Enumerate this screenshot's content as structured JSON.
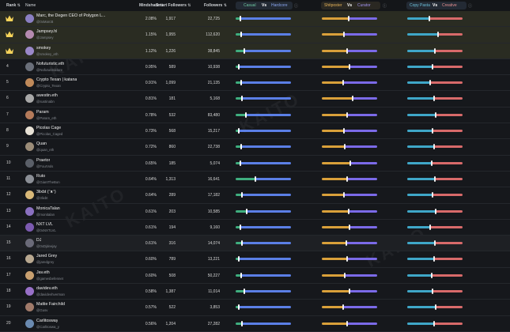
{
  "header": {
    "rank": "Rank",
    "name": "Name",
    "mindshare": "Mindshare",
    "smart_followers": "Smart Followers",
    "followers": "Followers",
    "casual": "Casual",
    "vs1": "Vs",
    "hardcore": "Hardcore",
    "shitposter": "Shitposter",
    "vs2": "Vs",
    "curator": "Curator",
    "copy_pasta": "Copy Pasta",
    "vs3": "Vs",
    "creative": "Creative",
    "watermark": "KAITO"
  },
  "colors": {
    "casual": "#3fae7f",
    "hardcore": "#5b7fe6",
    "shitposter": "#d9a03a",
    "curator": "#7b6ae8",
    "copy_pasta": "#3fa7c8",
    "creative": "#d86a6a",
    "top_row_bg": "#2a2c22",
    "crown": "#f5d35a"
  },
  "rows": [
    {
      "rank": "1",
      "crown": true,
      "name": "Marc, the Degen CEO of Polygon L...",
      "handle": "@0xMarcB",
      "mindshare": "2.08%",
      "smart_followers": "1,917",
      "followers": "22,725",
      "c": 0.08,
      "s": 0.48,
      "p": 0.4,
      "avatar": "#8a7fc2"
    },
    {
      "rank": "2",
      "crown": true,
      "name": "Jampsey.hl",
      "handle": "@Jampsey",
      "mindshare": "1.15%",
      "smart_followers": "1,955",
      "followers": "112,620",
      "c": 0.1,
      "s": 0.4,
      "p": 0.55,
      "avatar": "#b58ab0"
    },
    {
      "rank": "3",
      "crown": true,
      "name": "smokey",
      "handle": "@smokey_eth",
      "mindshare": "1.12%",
      "smart_followers": "1,226",
      "followers": "38,845",
      "c": 0.15,
      "s": 0.45,
      "p": 0.5,
      "avatar": "#9a88c9"
    },
    {
      "rank": "4",
      "crown": false,
      "name": "Nofuturistic.eth",
      "handle": "@Nofuturisticlore",
      "mindshare": "0.95%",
      "smart_followers": "589",
      "followers": "10,938",
      "c": 0.06,
      "s": 0.5,
      "p": 0.45,
      "avatar": "#6a6f7a"
    },
    {
      "rank": "5",
      "crown": false,
      "name": "Crypto Texan | katana",
      "handle": "@Crypto_Texan",
      "mindshare": "0.91%",
      "smart_followers": "1,099",
      "followers": "21,135",
      "c": 0.1,
      "s": 0.38,
      "p": 0.42,
      "avatar": "#c08a5a"
    },
    {
      "rank": "6",
      "crown": false,
      "name": "awestin.eth",
      "handle": "@sustinabn",
      "mindshare": "0.81%",
      "smart_followers": "181",
      "followers": "5,168",
      "c": 0.12,
      "s": 0.55,
      "p": 0.48,
      "avatar": "#a8a8a8"
    },
    {
      "rank": "7",
      "crown": false,
      "name": "Param",
      "handle": "@Param_eth",
      "mindshare": "0.78%",
      "smart_followers": "532",
      "followers": "83,480",
      "c": 0.18,
      "s": 0.45,
      "p": 0.52,
      "avatar": "#b47a5a"
    },
    {
      "rank": "8",
      "crown": false,
      "name": "Picolas Cage",
      "handle": "@Picolas_Caged",
      "mindshare": "0.73%",
      "smart_followers": "568",
      "followers": "15,217",
      "c": 0.06,
      "s": 0.4,
      "p": 0.45,
      "avatar": "#e8e2d6"
    },
    {
      "rank": "9",
      "crown": false,
      "name": "Quan",
      "handle": "@quan_eth",
      "mindshare": "0.72%",
      "smart_followers": "860",
      "followers": "22,738",
      "c": 0.1,
      "s": 0.42,
      "p": 0.48,
      "avatar": "#9b8c78"
    },
    {
      "rank": "10",
      "crown": false,
      "name": "Praetor",
      "handle": "@FourVols",
      "mindshare": "0.65%",
      "smart_followers": "185",
      "followers": "5,074",
      "c": 0.08,
      "s": 0.52,
      "p": 0.44,
      "avatar": "#5a5f68"
    },
    {
      "rank": "11",
      "crown": false,
      "name": "Ruto",
      "handle": "@GiantTheBon",
      "mindshare": "0.64%",
      "smart_followers": "1,313",
      "followers": "16,641",
      "c": 0.35,
      "s": 0.45,
      "p": 0.5,
      "avatar": "#8b8f96"
    },
    {
      "rank": "12",
      "crown": false,
      "name": "3lixbt (ᵔᴥᵔ)",
      "handle": "@3lixbt",
      "mindshare": "0.64%",
      "smart_followers": "289",
      "followers": "17,182",
      "c": 0.12,
      "s": 0.4,
      "p": 0.46,
      "avatar": "#d8b878"
    },
    {
      "rank": "13",
      "crown": false,
      "name": "MonicaTalan",
      "handle": "@monitalan",
      "mindshare": "0.61%",
      "smart_followers": "203",
      "followers": "10,585",
      "c": 0.2,
      "s": 0.48,
      "p": 0.52,
      "avatar": "#8a70c0"
    },
    {
      "rank": "14",
      "crown": false,
      "name": "NXT LVL",
      "handle": "@0xNXTLVL",
      "mindshare": "0.61%",
      "smart_followers": "194",
      "followers": "9,160",
      "c": 0.08,
      "s": 0.5,
      "p": 0.42,
      "avatar": "#7c5ab0"
    },
    {
      "rank": "15",
      "crown": false,
      "name": "DJ",
      "handle": "@0xDjdeejay",
      "mindshare": "0.61%",
      "smart_followers": "316",
      "followers": "14,074",
      "c": 0.12,
      "s": 0.44,
      "p": 0.5,
      "avatar": "#6a6a78"
    },
    {
      "rank": "16",
      "crown": false,
      "name": "Jared Grey",
      "handle": "@jaredgrey",
      "mindshare": "0.60%",
      "smart_followers": "789",
      "followers": "13,221",
      "c": 0.06,
      "s": 0.46,
      "p": 0.48,
      "avatar": "#b8a890"
    },
    {
      "rank": "17",
      "crown": false,
      "name": "Jav.eth",
      "handle": "@gamesbefennet",
      "mindshare": "0.60%",
      "smart_followers": "508",
      "followers": "50,227",
      "c": 0.1,
      "s": 0.42,
      "p": 0.44,
      "avatar": "#c8a070"
    },
    {
      "rank": "18",
      "crown": false,
      "name": "davidev.eth",
      "handle": "@davidevhverman",
      "mindshare": "0.58%",
      "smart_followers": "1,387",
      "followers": "11,014",
      "c": 0.15,
      "s": 0.5,
      "p": 0.46,
      "avatar": "#9870c8"
    },
    {
      "rank": "19",
      "crown": false,
      "name": "Mattie Fairchild",
      "handle": "@Gusv",
      "mindshare": "0.57%",
      "smart_followers": "522",
      "followers": "3,853",
      "c": 0.05,
      "s": 0.38,
      "p": 0.52,
      "avatar": "#a07a6a"
    },
    {
      "rank": "20",
      "crown": false,
      "name": "Carlitosway",
      "handle": "@Carlitoswa_y",
      "mindshare": "0.56%",
      "smart_followers": "1,204",
      "followers": "27,282",
      "c": 0.12,
      "s": 0.45,
      "p": 0.48,
      "avatar": "#6a8ab0"
    }
  ]
}
